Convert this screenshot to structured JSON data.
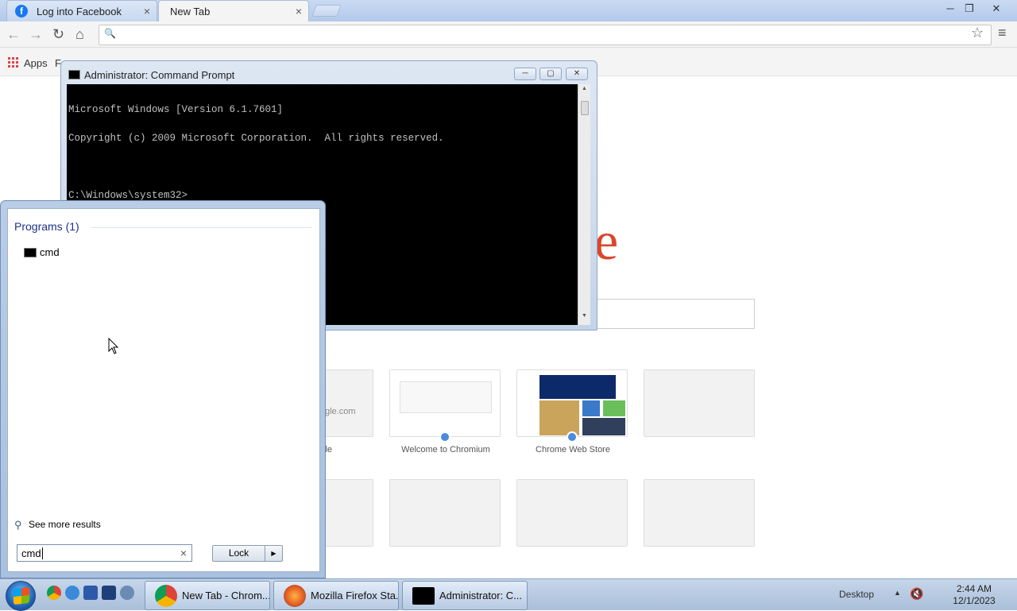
{
  "browser": {
    "tabs": [
      {
        "label": "Log into Facebook",
        "close": "×"
      },
      {
        "label": "New Tab",
        "close": "×"
      }
    ],
    "window_controls": {
      "minimize": "─",
      "restore": "❐",
      "close": "✕"
    },
    "nav": {
      "back": "←",
      "forward": "→",
      "reload": "↻",
      "home": "⌂",
      "search_glyph": "🔍",
      "star": "☆",
      "menu": "≡"
    },
    "bookmarks": {
      "apps_label": "Apps",
      "partial_label": "F"
    },
    "newtab": {
      "logo_fragment": "e",
      "thumbnails": [
        {
          "title": "le",
          "url_fragment": "gle.com"
        },
        {
          "title": "Welcome to Chromium"
        },
        {
          "title": "Chrome Web Store"
        }
      ]
    }
  },
  "cmd": {
    "title": "Administrator:  Command Prompt",
    "controls": {
      "minimize": "─",
      "maximize": "▢",
      "close": "✕"
    },
    "lines": [
      "Microsoft Windows [Version 6.1.7601]",
      "Copyright (c) 2009 Microsoft Corporation.  All rights reserved.",
      "",
      "C:\\Windows\\system32>"
    ],
    "scroll_up": "▲",
    "scroll_down": "▼"
  },
  "startmenu": {
    "section_header": "Programs (1)",
    "results": [
      {
        "label": "cmd"
      }
    ],
    "see_more": "See more results",
    "search_value": "cmd",
    "search_clear": "×",
    "lock_label": "Lock",
    "lock_arrow": "▶"
  },
  "taskbar": {
    "buttons": [
      {
        "label": "New Tab - Chrom..."
      },
      {
        "label": "Mozilla Firefox Sta..."
      },
      {
        "label": "Administrator:  C..."
      }
    ],
    "desktop_label": "Desktop",
    "tray_arrow": "▲",
    "volume_glyph": "🔇",
    "clock_time": "2:44 AM",
    "clock_date": "12/1/2023"
  },
  "colors": {
    "accent": "#1e3287",
    "google_red": "#d9472b",
    "facebook_blue": "#1877f2"
  }
}
